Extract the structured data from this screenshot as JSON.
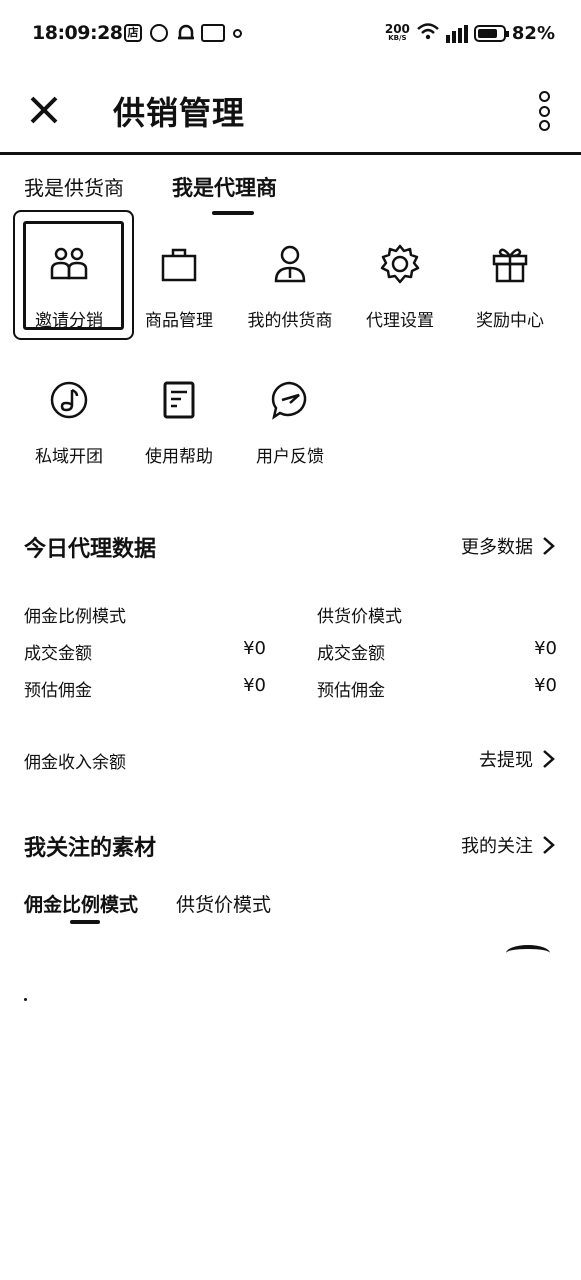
{
  "status_bar": {
    "time": "18:09:28",
    "net_speed_value": "200",
    "net_speed_unit": "KB/S",
    "battery_percent": "82%",
    "battery_level": 0.82,
    "left_icons": [
      "store-icon",
      "circle-app-icon",
      "bell-icon",
      "chat-icon",
      "small-dot-icon"
    ],
    "right_icons": [
      "wifi-icon",
      "hd-signal-icon",
      "battery-icon"
    ]
  },
  "header": {
    "title": "供销管理",
    "close_icon": "close-icon",
    "more_icon": "more-vertical-icon"
  },
  "role_tabs": [
    {
      "label": "我是供货商",
      "active": false
    },
    {
      "label": "我是代理商",
      "active": true
    }
  ],
  "feature_grid": [
    {
      "label": "邀请分销",
      "icon": "invite-users-icon"
    },
    {
      "label": "商品管理",
      "icon": "shopping-bag-icon"
    },
    {
      "label": "我的供货商",
      "icon": "person-icon"
    },
    {
      "label": "代理设置",
      "icon": "gear-icon"
    },
    {
      "label": "奖励中心",
      "icon": "gift-icon"
    },
    {
      "label": "私域开团",
      "icon": "music-note-circle-icon"
    },
    {
      "label": "使用帮助",
      "icon": "help-doc-icon"
    },
    {
      "label": "用户反馈",
      "icon": "feedback-bubble-icon"
    }
  ],
  "today_data": {
    "title": "今日代理数据",
    "more_link": "更多数据",
    "left": {
      "mode": "佣金比例模式",
      "rows": [
        {
          "label": "成交金额",
          "value": "¥0"
        },
        {
          "label": "预估佣金",
          "value": "¥0"
        }
      ]
    },
    "right": {
      "mode": "供货价模式",
      "rows": [
        {
          "label": "成交金额",
          "value": "¥0"
        },
        {
          "label": "预估佣金",
          "value": "¥0"
        }
      ]
    },
    "balance_label": "佣金收入余额",
    "withdraw_link": "去提现"
  },
  "materials": {
    "title": "我关注的素材",
    "my_follow_link": "我的关注",
    "tabs": [
      {
        "label": "佣金比例模式",
        "active": true
      },
      {
        "label": "供货价模式",
        "active": false
      }
    ]
  }
}
